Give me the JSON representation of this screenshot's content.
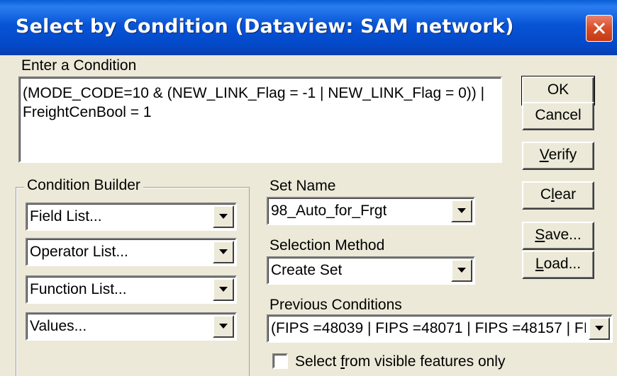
{
  "window": {
    "title": "Select by Condition (Dataview: SAM network)"
  },
  "condition": {
    "label": "Enter a Condition",
    "line1": "(MODE_CODE=10 & (NEW_LINK_Flag = -1 | NEW_LINK_Flag = 0)) |",
    "line2": "FreightCenBool = 1"
  },
  "buttons": {
    "ok": "OK",
    "cancel": "Cancel",
    "verify_mnemonic": "V",
    "verify_rest": "erify",
    "clear_pre": "C",
    "clear_mnemonic": "l",
    "clear_rest": "ear",
    "save_mnemonic": "S",
    "save_rest": "ave...",
    "load_mnemonic": "L",
    "load_rest": "oad..."
  },
  "builder": {
    "label": "Condition Builder",
    "field_list": "Field List...",
    "operator_list": "Operator List...",
    "function_list": "Function List...",
    "values": "Values..."
  },
  "set_name": {
    "label": "Set Name",
    "value": "98_Auto_for_Frgt"
  },
  "selection_method": {
    "label": "Selection Method",
    "value": "Create Set"
  },
  "previous_conditions": {
    "label": "Previous Conditions",
    "value": "(FIPS =48039 | FIPS =48071 | FIPS =48157 | FI"
  },
  "visible_only": {
    "label_pre": "Select ",
    "label_mnemonic": "f",
    "label_rest": "rom visible features only",
    "checked": false
  }
}
